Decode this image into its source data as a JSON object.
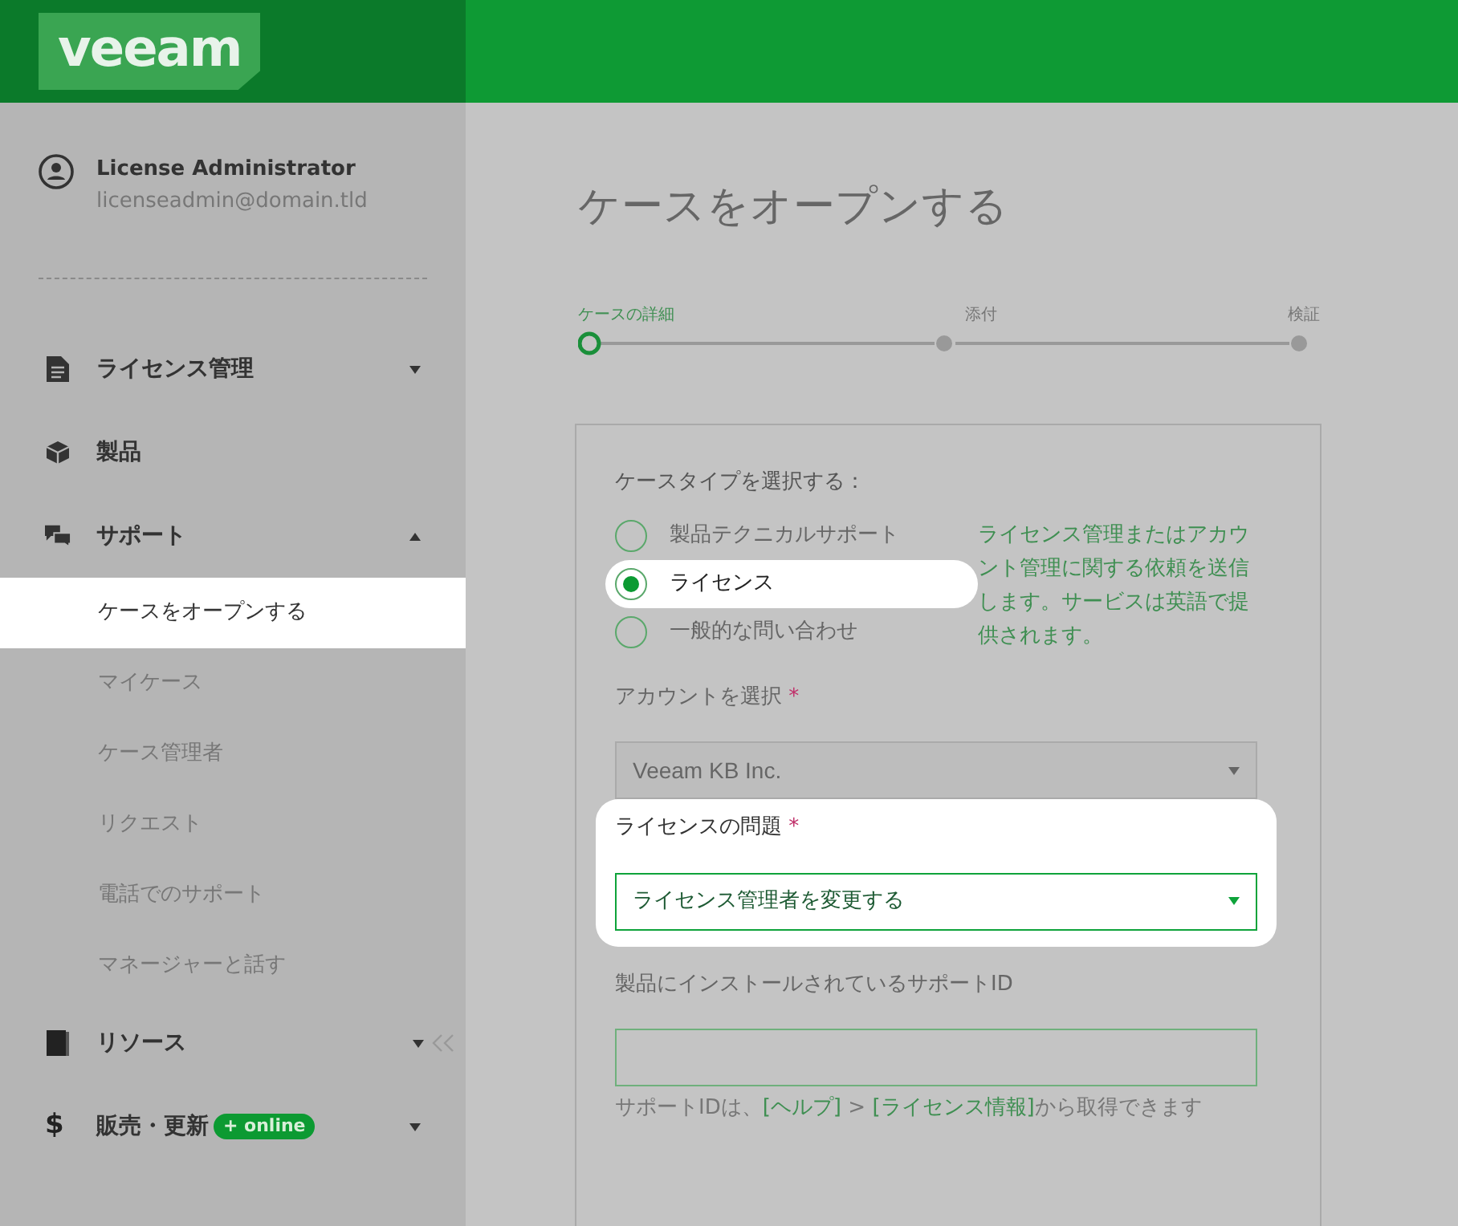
{
  "header": {
    "logo": "veeam"
  },
  "user": {
    "name": "License Administrator",
    "email": "licenseadmin@domain.tld"
  },
  "sidebar": {
    "items": [
      {
        "label": "ライセンス管理",
        "expanded": false
      },
      {
        "label": "製品"
      },
      {
        "label": "サポート",
        "expanded": true,
        "children": [
          {
            "label": "ケースをオープンする",
            "selected": true
          },
          {
            "label": "マイケース",
            "selected": false
          },
          {
            "label": "ケース管理者",
            "selected": false
          },
          {
            "label": "リクエスト",
            "selected": false
          },
          {
            "label": "電話でのサポート",
            "selected": false
          },
          {
            "label": "マネージャーと話す",
            "selected": false
          }
        ]
      },
      {
        "label": "リソース",
        "expanded": false,
        "collapse": true
      },
      {
        "symbol": "$",
        "label": "販売・更新",
        "badge": "+ online",
        "expanded": false
      }
    ]
  },
  "page": {
    "title": "ケースをオープンする"
  },
  "steps": [
    {
      "label": "ケースの詳細",
      "selected": true
    },
    {
      "label": "添付",
      "selected": false
    },
    {
      "label": "検証",
      "selected": false
    }
  ],
  "form": {
    "case_type_label": "ケースタイプを選択する：",
    "case_types": [
      {
        "label": "製品テクニカルサポート",
        "selected": false
      },
      {
        "label": "ライセンス",
        "selected": true
      },
      {
        "label": "一般的な問い合わせ",
        "selected": false
      }
    ],
    "case_type_help": "ライセンス管理またはアカウント管理に関する依頼を送信します。サービスは英語で提供されます。",
    "fields": [
      {
        "kind": "select",
        "label": "アカウントを選択",
        "required_mark": "*",
        "value": "Veeam KB Inc.",
        "highlighted": false
      },
      {
        "kind": "select",
        "label": "ライセンスの問題",
        "required_mark": "*",
        "value": "ライセンス管理者を変更する",
        "highlighted": true
      },
      {
        "kind": "input",
        "label": "製品にインストールされているサポートID",
        "highlighted": false,
        "help": [
          {
            "kind": "text",
            "text": "サポートIDは、"
          },
          {
            "kind": "link",
            "text": "[ヘルプ]"
          },
          {
            "kind": "text",
            "text": " > "
          },
          {
            "kind": "link",
            "text": "[ライセンス情報]"
          },
          {
            "kind": "text",
            "text": "から取得できます"
          }
        ]
      }
    ]
  }
}
